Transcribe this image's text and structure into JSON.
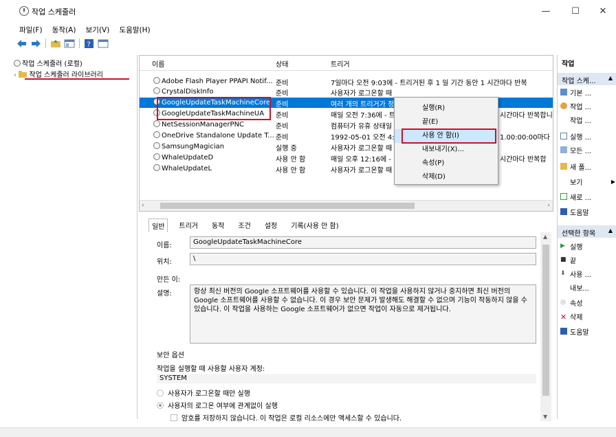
{
  "window": {
    "title": "작업 스케줄러",
    "controls": [
      "—",
      "☐",
      "✕"
    ]
  },
  "menu": [
    "파일(F)",
    "동작(A)",
    "보기(V)",
    "도움말(H)"
  ],
  "tree": {
    "root": "작업 스케줄러 (로컬)",
    "library": "작업 스케줄러 라이브러리"
  },
  "list": {
    "headers": {
      "name": "이름",
      "status": "상태",
      "trigger": "트리거"
    },
    "rows": [
      {
        "name": "Adobe Flash Player PPAPI Notif...",
        "status": "준비",
        "trigger": "7일마다 오전 9:03에 - 트리거된 후 1 일 기간 동안 1 시간마다 반복"
      },
      {
        "name": "CrystalDiskInfo",
        "status": "준비",
        "trigger": "사용자가 로그온할 때"
      },
      {
        "name": "GoogleUpdateTaskMachineCore",
        "status": "준비",
        "trigger": "여러 개의 트리거가 정"
      },
      {
        "name": "GoogleUpdateTaskMachineUA",
        "status": "준비",
        "trigger": "매일 오전 7:36에 - 트"
      },
      {
        "name": "NetSessionManagerPNC",
        "status": "준비",
        "trigger": "컴퓨터가 유휴 상태일"
      },
      {
        "name": "OneDrive Standalone Update T...",
        "status": "준비",
        "trigger": "1992-05-01 오전 4:0"
      },
      {
        "name": "SamsungMagician",
        "status": "실행 중",
        "trigger": "사용자가 로그온할 때"
      },
      {
        "name": "WhaleUpdateD",
        "status": "사용 안 함",
        "trigger": "매일 오후 12:16에 - "
      },
      {
        "name": "WhaleUpdateL",
        "status": "사용 안 함",
        "trigger": "사용자가 로그온할 때"
      }
    ],
    "trigger_tails": [
      "시간마다 반복합니",
      "1.00:00:00마다",
      "시간마다 반복합"
    ]
  },
  "context_menu": [
    "실행(R)",
    "끝(E)",
    "사용 안 함(I)",
    "내보내기(X)...",
    "속성(P)",
    "삭제(D)"
  ],
  "detail": {
    "tabs": [
      "일반",
      "트리거",
      "동작",
      "조건",
      "설정",
      "기록(사용 안 함)"
    ],
    "name_label": "이름:",
    "name_value": "GoogleUpdateTaskMachineCore",
    "location_label": "위치:",
    "location_value": "\\",
    "author_label": "만든 이:",
    "desc_label": "설명:",
    "description": "항상 최신 버전의 Google 소프트웨어를 사용할 수 있습니다. 이 작업을 사용하지 않거나 중지하면 최신 버전의 Google 소프트웨어를 사용할 수 없습니다. 이 경우 보안 문제가 발생해도 해결할 수 없으며 기능이 작동하지 않을 수 있습니다. 이 작업을 사용하는 Google 소프트웨어가 없으면 작업이 자동으로 제거됩니다.",
    "security_title": "보안 옵션",
    "run_as_label": "작업을 실행할 때 사용할 사용자 계정:",
    "run_as_value": "SYSTEM",
    "radio1": "사용자가 로그온할 때만 실행",
    "radio2": "사용자의 로그온 여부에 관계없이 실행",
    "check1": "암호를 저장하지 않습니다. 이 작업은 로컬 리소스에만 액세스할 수 있습니다."
  },
  "actions": {
    "header": "작업",
    "section1": "작업 스케...",
    "items1": [
      "기본 ...",
      "작업 ...",
      "작업 ...",
      "실행 ...",
      "모든 ...",
      "새 폴...",
      "보기",
      "새로 ...",
      "도움말"
    ],
    "section2": "선택한 항목",
    "items2": [
      "실행",
      "끝",
      "사용 ...",
      "내보...",
      "속성",
      "삭제",
      "도움말"
    ]
  }
}
